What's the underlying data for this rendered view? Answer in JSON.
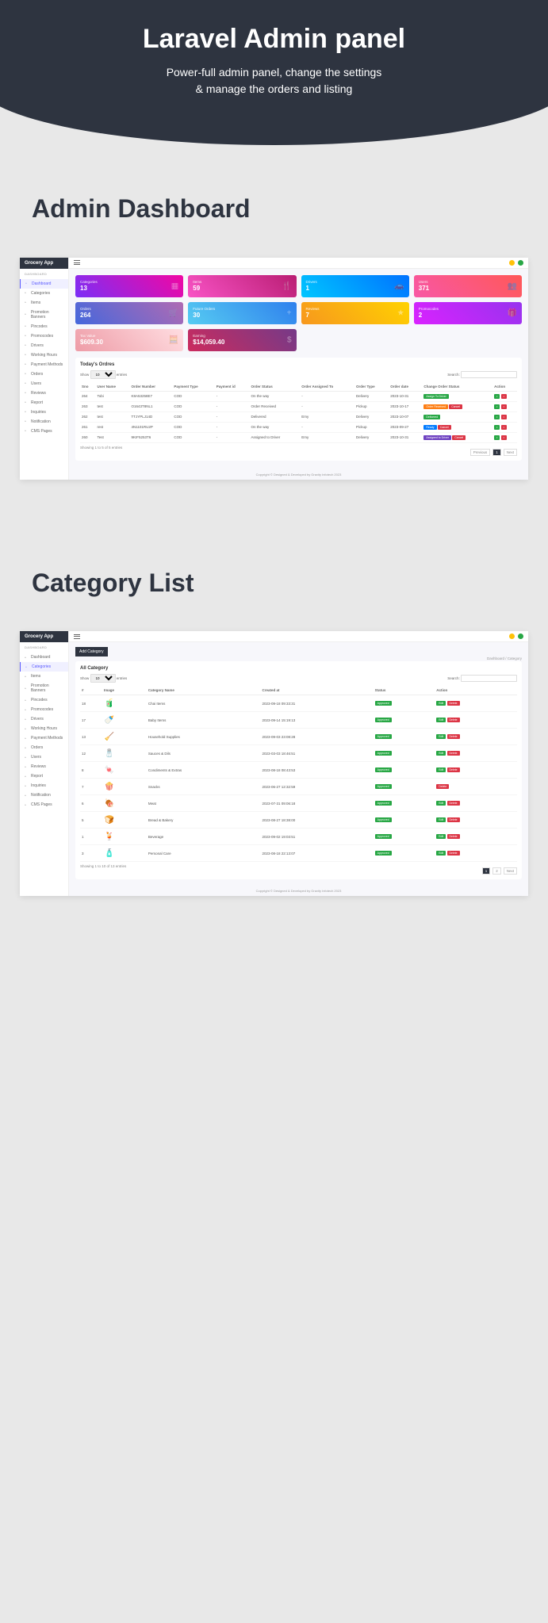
{
  "hero": {
    "title": "Laravel Admin panel",
    "line1": "Power-full admin panel, change the settings",
    "line2": "& manage the orders and listing"
  },
  "section1_title": "Admin Dashboard",
  "section2_title": "Category List",
  "app_name": "Grocery App",
  "menu_label": "DASHBOARD",
  "menu": [
    {
      "label": "Dashboard"
    },
    {
      "label": "Categories"
    },
    {
      "label": "Items"
    },
    {
      "label": "Promotion Banners"
    },
    {
      "label": "Pincodes"
    },
    {
      "label": "Promocodes"
    },
    {
      "label": "Drivers"
    },
    {
      "label": "Working Hours"
    },
    {
      "label": "Payment Methods"
    },
    {
      "label": "Orders"
    },
    {
      "label": "Users"
    },
    {
      "label": "Reviews"
    },
    {
      "label": "Report"
    },
    {
      "label": "Inquiries"
    },
    {
      "label": "Notification"
    },
    {
      "label": "CMS Pages"
    }
  ],
  "cards": [
    {
      "label": "Categories",
      "value": "13",
      "grad": "linear-gradient(45deg,#7b2ff7,#f107a3)",
      "icon": "▦"
    },
    {
      "label": "Items",
      "value": "59",
      "grad": "linear-gradient(45deg,#f953c6,#b91d73)",
      "icon": "🍴"
    },
    {
      "label": "Drivers",
      "value": "1",
      "grad": "linear-gradient(45deg,#00c6ff,#0072ff)",
      "icon": "🚗"
    },
    {
      "label": "Users",
      "value": "371",
      "grad": "linear-gradient(45deg,#f857a6,#ff5858)",
      "icon": "👥"
    },
    {
      "label": "Orders",
      "value": "264",
      "grad": "linear-gradient(45deg,#4568dc,#b06ab3)",
      "icon": "🛒"
    },
    {
      "label": "Future Orders",
      "value": "30",
      "grad": "linear-gradient(45deg,#56ccf2,#2f80ed)",
      "icon": "+"
    },
    {
      "label": "Reviews",
      "value": "7",
      "grad": "linear-gradient(45deg,#f7971e,#ffd200)",
      "icon": "★"
    },
    {
      "label": "Promocodes",
      "value": "2",
      "grad": "linear-gradient(45deg,#da22ff,#9733ee)",
      "icon": "🎁"
    },
    {
      "label": "Tax Value",
      "value": "$609.30",
      "grad": "linear-gradient(45deg,#ee9ca7,#ffdde1)",
      "icon": "🧮"
    },
    {
      "label": "Earning",
      "value": "$14,059.40",
      "grad": "linear-gradient(45deg,#cc2b5e,#753a88)",
      "icon": "$"
    }
  ],
  "orders_title": "Today's Ordres",
  "show_label": "Show",
  "entries_label": "entries",
  "search_label": "Search:",
  "orders_cols": [
    "Sno",
    "User Name",
    "Order Number",
    "Payment Type",
    "Payment id",
    "Order Status",
    "Order Assigned To",
    "Order Type",
    "Order date",
    "Change Order Status",
    "Action"
  ],
  "orders_rows": [
    {
      "sno": "264",
      "user": "Tobi",
      "num": "K8A53258E7",
      "ptype": "COD",
      "pid": "-",
      "status": "On the way",
      "assigned": "-",
      "otype": "Delivery",
      "date": "2023-10-31",
      "chg": [
        "Assign To Driver"
      ],
      "chgcls": [
        "b-grn"
      ],
      "act": [
        "b-grn",
        "b-red"
      ]
    },
    {
      "sno": "263",
      "user": "test",
      "num": "O1643T8NL1",
      "ptype": "COD",
      "pid": "-",
      "status": "Order Received",
      "assigned": "-",
      "otype": "Pickup",
      "date": "2023-10-17",
      "chg": [
        "Order Received",
        "Cancel"
      ],
      "chgcls": [
        "b-org",
        "b-red"
      ],
      "act": [
        "b-grn",
        "b-red"
      ]
    },
    {
      "sno": "262",
      "user": "test",
      "num": "TTJYPLJ14D",
      "ptype": "COD",
      "pid": "-",
      "status": "Delivered",
      "assigned": "Emy",
      "otype": "Delivery",
      "date": "2023-10-07",
      "chg": [
        "Delivered"
      ],
      "chgcls": [
        "b-grn"
      ],
      "act": [
        "b-grn",
        "b-red"
      ]
    },
    {
      "sno": "261",
      "user": "rest",
      "num": "4N1101RU2P",
      "ptype": "COD",
      "pid": "-",
      "status": "On the way",
      "assigned": "-",
      "otype": "Pickup",
      "date": "2023-09-27",
      "chg": [
        "Ready",
        "Cancel"
      ],
      "chgcls": [
        "b-blu",
        "b-red"
      ],
      "act": [
        "b-grn",
        "b-red"
      ]
    },
    {
      "sno": "260",
      "user": "Test",
      "num": "9KIF5253T6",
      "ptype": "COD",
      "pid": "-",
      "status": "Assigned to Driver",
      "assigned": "Emy",
      "otype": "Delivery",
      "date": "2023-10-31",
      "chg": [
        "Assigned to Driver",
        "Cancel"
      ],
      "chgcls": [
        "b-pur",
        "b-red"
      ],
      "act": [
        "b-grn",
        "b-red"
      ]
    }
  ],
  "orders_footer": "Showing 1 to 5 of 5 entries",
  "prev": "Previous",
  "next": "Next",
  "page1": "1",
  "copyright": "Copyright © Designed & Developed by Gravity Infotech 2023",
  "add_cat": "Add Category",
  "all_cat": "All Category",
  "breadcrumb": "Dashboard / Category",
  "cat_cols": [
    "#",
    "Image",
    "Category Name",
    "Created at",
    "Status",
    "Action"
  ],
  "cat_rows": [
    {
      "n": "18",
      "img": "🧃",
      "name": "Chai Items",
      "date": "2023-09-18 09:33:31",
      "act": [
        "b-grn",
        "b-red"
      ]
    },
    {
      "n": "17",
      "img": "🍼",
      "name": "Baby Items",
      "date": "2023-09-14 15:19:13",
      "act": [
        "b-grn",
        "b-red"
      ]
    },
    {
      "n": "13",
      "img": "🧹",
      "name": "Household Supplies",
      "date": "2023-09-03 23:08:28",
      "act": [
        "b-grn",
        "b-red"
      ]
    },
    {
      "n": "12",
      "img": "🧂",
      "name": "Sauces & Dils",
      "date": "2023-03-03 18:46:51",
      "act": [
        "b-grn",
        "b-red"
      ]
    },
    {
      "n": "8",
      "img": "🍬",
      "name": "Condiments & Extras",
      "date": "2023-08-18 08:43:53",
      "act": [
        "b-grn",
        "b-red"
      ]
    },
    {
      "n": "7",
      "img": "🍿",
      "name": "Snacks",
      "date": "2023-06-27 12:32:59",
      "act": "b-red"
    },
    {
      "n": "6",
      "img": "🍖",
      "name": "Meat",
      "date": "2023-07-31 09:06:18",
      "act": [
        "b-grn",
        "b-red"
      ]
    },
    {
      "n": "5",
      "img": "🍞",
      "name": "Bread & Bakery",
      "date": "2023-08-27 18:38:00",
      "act": [
        "b-grn",
        "b-red"
      ]
    },
    {
      "n": "1",
      "img": "🍹",
      "name": "Beverage",
      "date": "2023-09-02 19:03:51",
      "act": [
        "b-grn",
        "b-red"
      ]
    },
    {
      "n": "3",
      "img": "🧴",
      "name": "Personal Care",
      "date": "2023-08-18 22:13:07",
      "act": [
        "b-grn",
        "b-red"
      ]
    }
  ],
  "cat_footer": "Showing 1 to 10 of 13 entries",
  "status_approved": "Approved",
  "act_edit": "Edit",
  "act_del": "Delete"
}
